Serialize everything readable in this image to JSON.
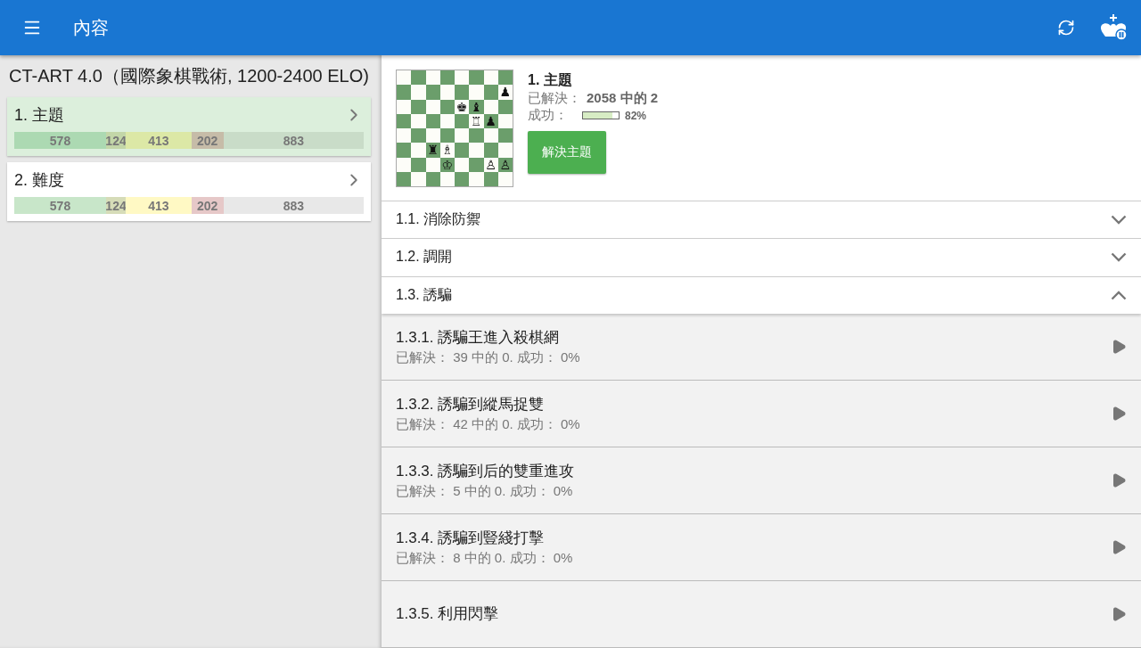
{
  "app_bar": {
    "title": "內容"
  },
  "course_title": "CT-ART 4.0（國際象棋戰術, 1200-2400 ELO)",
  "chapters": [
    {
      "label": "1. 主題",
      "selected": true,
      "segments": [
        {
          "value": "578",
          "color": "#acd9b2"
        },
        {
          "value": "124",
          "color": "#c3d6a8"
        },
        {
          "value": "413",
          "color": "#dce8a6"
        },
        {
          "value": "202",
          "color": "#c6bca8"
        },
        {
          "value": "883",
          "color": "#c9dcc8"
        }
      ]
    },
    {
      "label": "2. 難度",
      "selected": false,
      "segments": [
        {
          "value": "578",
          "color": "#c8e6c9"
        },
        {
          "value": "124",
          "color": "#d6dcb8"
        },
        {
          "value": "413",
          "color": "#fff9c4"
        },
        {
          "value": "202",
          "color": "#e6c8c8"
        },
        {
          "value": "883",
          "color": "#e8e8e8"
        }
      ]
    }
  ],
  "summary": {
    "title": "1. 主題",
    "solved_label": "已解決：",
    "solved_value": "2058 中的 2",
    "success_label": "成功：",
    "success": {
      "level": 0.82,
      "reading": "82%"
    },
    "button": "解決主題",
    "board": [
      [
        {
          "dark": false
        },
        {
          "dark": true
        },
        {
          "dark": false
        },
        {
          "dark": true
        },
        {
          "dark": false
        },
        {
          "dark": true
        },
        {
          "dark": false
        },
        {
          "dark": true
        }
      ],
      [
        {
          "dark": true
        },
        {
          "dark": false
        },
        {
          "dark": true
        },
        {
          "dark": false
        },
        {
          "dark": true
        },
        {
          "dark": false
        },
        {
          "dark": true
        },
        {
          "dark": false,
          "piece": "♟"
        }
      ],
      [
        {
          "dark": false
        },
        {
          "dark": true
        },
        {
          "dark": false
        },
        {
          "dark": true
        },
        {
          "dark": false,
          "piece": "♚"
        },
        {
          "dark": true,
          "piece": "♝"
        },
        {
          "dark": false
        },
        {
          "dark": true
        }
      ],
      [
        {
          "dark": true
        },
        {
          "dark": false
        },
        {
          "dark": true
        },
        {
          "dark": false
        },
        {
          "dark": true
        },
        {
          "dark": false,
          "piece": "♖"
        },
        {
          "dark": true,
          "piece": "♟"
        },
        {
          "dark": false
        }
      ],
      [
        {
          "dark": false
        },
        {
          "dark": true
        },
        {
          "dark": false
        },
        {
          "dark": true
        },
        {
          "dark": false
        },
        {
          "dark": true
        },
        {
          "dark": false
        },
        {
          "dark": true
        }
      ],
      [
        {
          "dark": true
        },
        {
          "dark": false
        },
        {
          "dark": true,
          "piece": "♜"
        },
        {
          "dark": false,
          "piece": "♗"
        },
        {
          "dark": true
        },
        {
          "dark": false
        },
        {
          "dark": true
        },
        {
          "dark": false
        }
      ],
      [
        {
          "dark": false
        },
        {
          "dark": true
        },
        {
          "dark": false
        },
        {
          "dark": true,
          "piece": "♔"
        },
        {
          "dark": false
        },
        {
          "dark": true
        },
        {
          "dark": false,
          "piece": "♙"
        },
        {
          "dark": true,
          "piece": "♙"
        }
      ],
      [
        {
          "dark": true
        },
        {
          "dark": false
        },
        {
          "dark": true
        },
        {
          "dark": false
        },
        {
          "dark": true
        },
        {
          "dark": false
        },
        {
          "dark": true
        },
        {
          "dark": false
        }
      ]
    ]
  },
  "sections": [
    {
      "label": "1.1. 消除防禦",
      "expanded": false
    },
    {
      "label": "1.2. 調開",
      "expanded": false
    },
    {
      "label": "1.3. 誘騙",
      "expanded": true,
      "children": [
        {
          "title": "1.3.1. 誘騙王進入殺棋網",
          "stats": "已解決： 39 中的 0. 成功： 0%"
        },
        {
          "title": "1.3.2. 誘騙到縱馬捉雙",
          "stats": "已解決： 42 中的 0. 成功： 0%"
        },
        {
          "title": "1.3.3. 誘騙到后的雙重進攻",
          "stats": "已解決： 5 中的 0. 成功： 0%"
        },
        {
          "title": "1.3.4. 誘騙到豎綫打擊",
          "stats": "已解決： 8 中的 0. 成功： 0%"
        },
        {
          "title": "1.3.5. 利用閃擊"
        }
      ]
    }
  ]
}
